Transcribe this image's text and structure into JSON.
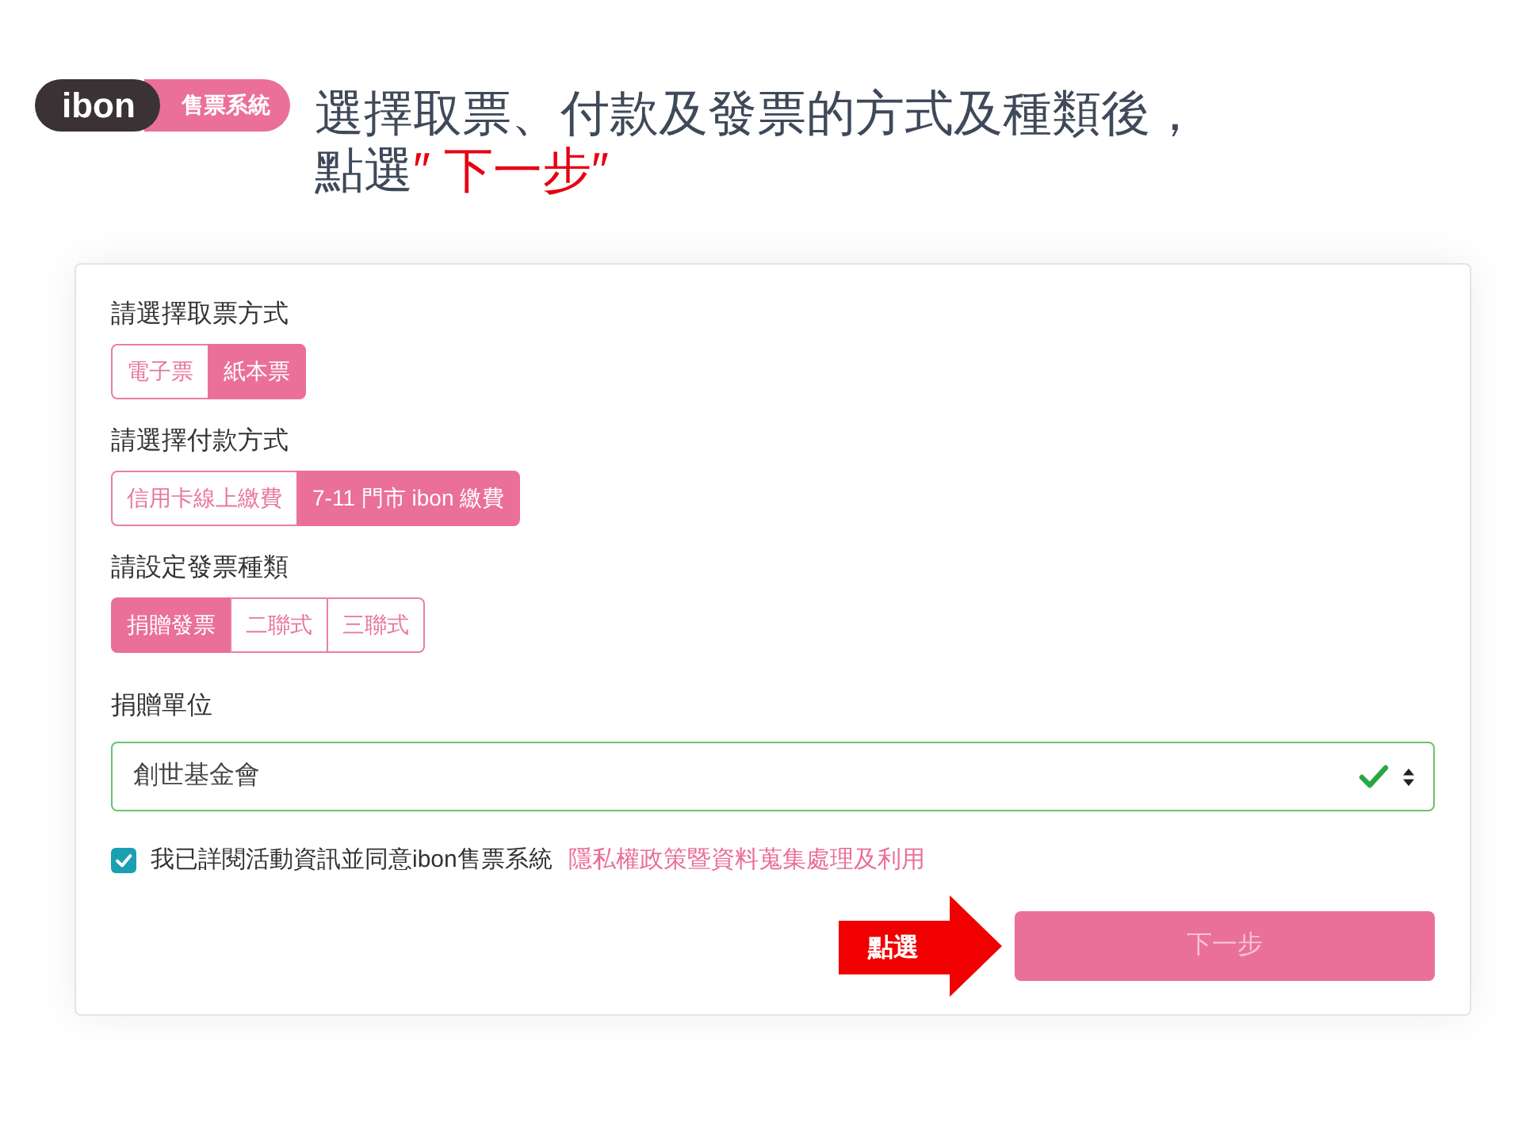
{
  "logo": {
    "wordmark": "ibon",
    "tag": "售票系統"
  },
  "instruction": {
    "line_1": "選擇取票、付款及發票的方式及種類後，",
    "line_2": "點選",
    "line_2_highlight": "″ 下一步″"
  },
  "form": {
    "option_groups": [
      {
        "label": "請選擇取票方式",
        "options": [
          {
            "label": "電子票",
            "selected": false
          },
          {
            "label": "紙本票",
            "selected": true
          }
        ]
      },
      {
        "label": "請選擇付款方式",
        "options": [
          {
            "label": "信用卡線上繳費",
            "selected": false
          },
          {
            "label": "7-11 門市 ibon 繳費",
            "selected": true
          }
        ]
      },
      {
        "label": "請設定發票種類",
        "options": [
          {
            "label": "捐贈發票",
            "selected": true
          },
          {
            "label": "二聯式",
            "selected": false
          },
          {
            "label": "三聯式",
            "selected": false
          }
        ]
      }
    ],
    "donation": {
      "label": "捐贈單位",
      "value": "創世基金會",
      "valid": true
    },
    "agreement": {
      "checked": true,
      "text": "我已詳閱活動資訊並同意ibon售票系統",
      "link": "隱私權政策暨資料蒐集處理及利用"
    },
    "callout": {
      "text": "點選"
    },
    "next_button": {
      "label": "下一步",
      "disabled": true
    }
  }
}
